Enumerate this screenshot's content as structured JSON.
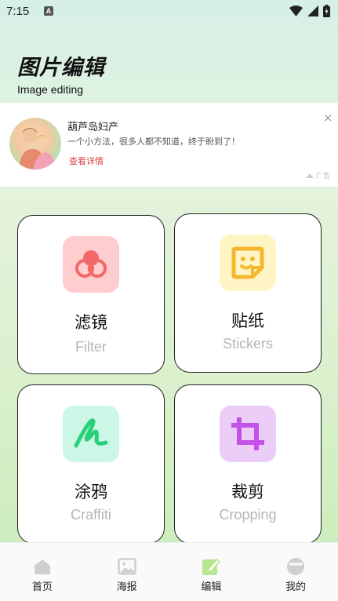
{
  "status_bar": {
    "time": "7:15",
    "notification_letter": "A"
  },
  "header": {
    "title": "图片编辑",
    "subtitle": "Image editing"
  },
  "ad": {
    "title": "葫芦岛妇产",
    "description": "一个小方法，很多人都不知道，终于盼到了！",
    "link_label": "查看详情",
    "close_glyph": "×",
    "tag_label": "广告"
  },
  "cards": [
    {
      "id": "filter",
      "label": "滤镜",
      "sublabel": "Filter",
      "icon": "filter-icon",
      "bg": "#ffcdcd",
      "fg": "#f06868"
    },
    {
      "id": "stickers",
      "label": "贴纸",
      "sublabel": "Stickers",
      "icon": "sticker-icon",
      "bg": "#fff5c4",
      "fg": "#f4b830"
    },
    {
      "id": "graffiti",
      "label": "涂鸦",
      "sublabel": "Craffiti",
      "icon": "scribble-icon",
      "bg": "#ccf7e6",
      "fg": "#28d07a"
    },
    {
      "id": "cropping",
      "label": "裁剪",
      "sublabel": "Cropping",
      "icon": "crop-icon",
      "bg": "#ebcdf7",
      "fg": "#c452e8"
    }
  ],
  "nav": [
    {
      "label": "首页",
      "icon": "home-icon",
      "active": false
    },
    {
      "label": "海报",
      "icon": "image-icon",
      "active": false
    },
    {
      "label": "编辑",
      "icon": "edit-icon",
      "active": true
    },
    {
      "label": "我的",
      "icon": "profile-icon",
      "active": false
    }
  ],
  "colors": {
    "nav_inactive": "#cfcfcf",
    "nav_active": "#b6e68f",
    "ad_link": "#d94040"
  }
}
